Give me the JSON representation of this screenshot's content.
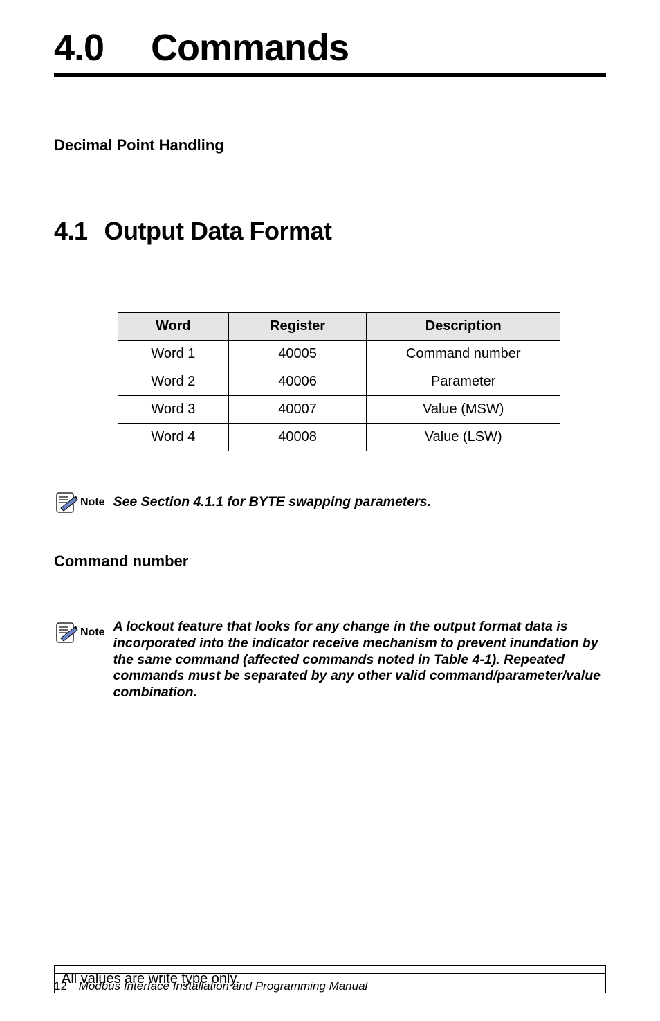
{
  "chapter": {
    "number": "4.0",
    "title": "Commands"
  },
  "sub1": "Decimal Point Handling",
  "section": {
    "number": "4.1",
    "title": "Output Data Format"
  },
  "table": {
    "headers": {
      "word": "Word",
      "register": "Register",
      "description": "Description"
    },
    "rows": [
      {
        "word": "Word 1",
        "register": "40005",
        "description": "Command number"
      },
      {
        "word": "Word 2",
        "register": "40006",
        "description": "Parameter"
      },
      {
        "word": "Word 3",
        "register": "40007",
        "description": "Value (MSW)"
      },
      {
        "word": "Word 4",
        "register": "40008",
        "description": "Value (LSW)"
      }
    ],
    "footer": "All values are write type only."
  },
  "note1": {
    "label": "Note",
    "text": "See Section 4.1.1 for BYTE swapping parameters."
  },
  "sub2": "Command number",
  "note2": {
    "label": "Note",
    "text": "A lockout feature that looks for any change in the output format data is incorporated into the indicator receive mechanism to prevent inundation by the same command (affected commands noted in Table 4-1). Repeated commands must be separated by any other valid command/parameter/value combination."
  },
  "footer": {
    "page": "12",
    "doc": "Modbus Interface Installation and Programming Manual"
  }
}
